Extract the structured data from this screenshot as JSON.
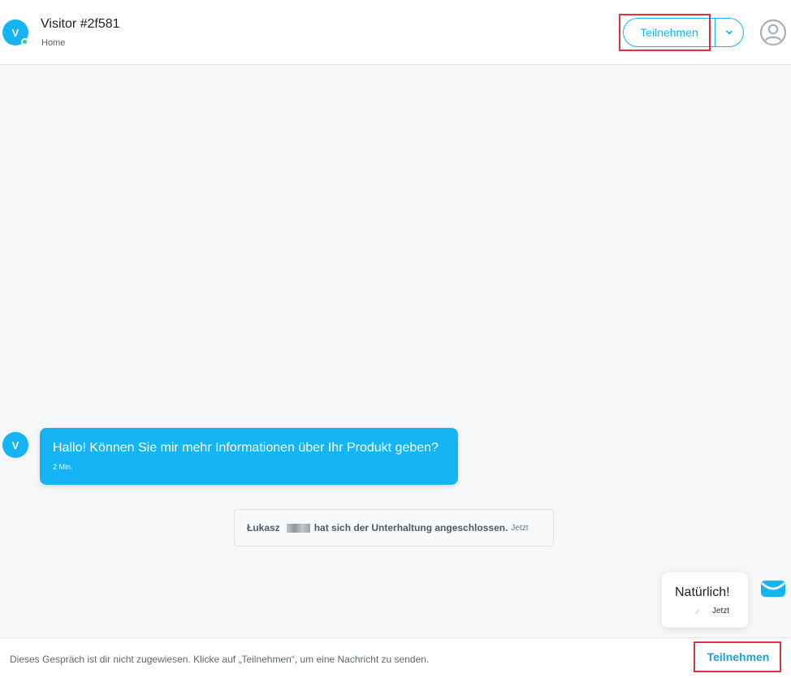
{
  "header": {
    "avatar_initial": "V",
    "visitor_name": "Visitor #2f581",
    "visitor_page": "Home",
    "join_label": "Teilnehmen"
  },
  "messages": {
    "incoming": {
      "avatar_initial": "V",
      "text": "Hallo! Können Sie mir mehr Informationen über Ihr Produkt geben?",
      "time": "2 Min."
    },
    "system": {
      "name": "Łukasz",
      "text": "hat sich der Unterhaltung angeschlossen.",
      "time": "Jetzt"
    },
    "outgoing": {
      "text": "Natürlich!",
      "time": "Jetzt"
    }
  },
  "footer": {
    "note": "Dieses Gespräch ist dir nicht zugewiesen. Klicke auf „Teilnehmen“, um eine Nachricht zu senden.",
    "join_label": "Teilnehmen"
  },
  "colors": {
    "accent": "#14b4f5",
    "annotation": "#e0323c",
    "online": "#2ed47a"
  },
  "icons": [
    "chevron-down-icon",
    "user-icon",
    "mail-icon",
    "check-icon"
  ]
}
